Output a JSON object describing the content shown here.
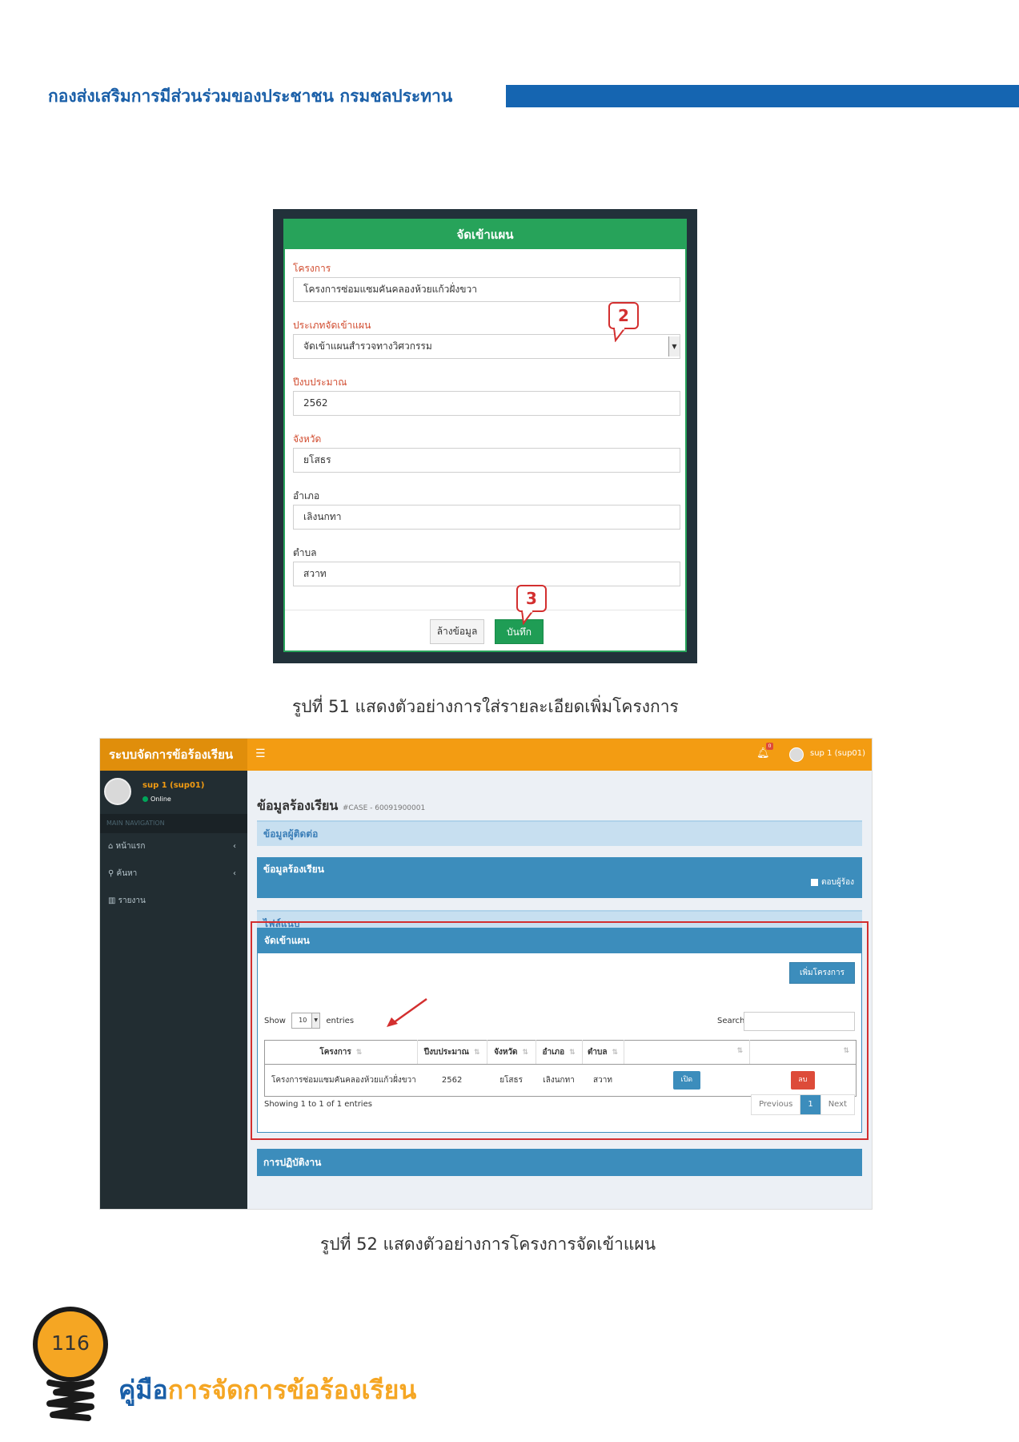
{
  "header": {
    "title": "กองส่งเสริมการมีส่วนร่วมของประชาชน กรมชลประทาน"
  },
  "figure51": {
    "panel_title": "จัดเข้าแผน",
    "fields": [
      {
        "label": "โครงการ",
        "value": "โครงการซ่อมแซมคันคลองห้วยแก้วฝั่งขวา"
      },
      {
        "label": "ประเภทจัดเข้าแผน",
        "value": "จัดเข้าแผนสำรวจทางวิศวกรรม"
      },
      {
        "label": "ปีงบประมาณ",
        "value": "2562"
      },
      {
        "label": "จังหวัด",
        "value": "ยโสธร"
      },
      {
        "label": "อำเภอ",
        "value": "เลิงนกทา"
      },
      {
        "label": "ตำบล",
        "value": "สวาท"
      }
    ],
    "clear_button": "ล้างข้อมูล",
    "save_button": "บันทึก",
    "callout_2": "2",
    "callout_3": "3",
    "caption": "รูปที่ 51 แสดงตัวอย่างการใส่รายละเอียดเพิ่มโครงการ"
  },
  "figure52": {
    "brand": "ระบบจัดการข้อร้องเรียน",
    "top_user": "sup 1 (sup01)",
    "notification_count": "0",
    "sidebar": {
      "user_name": "sup 1 (sup01)",
      "status": "Online",
      "nav_header": "MAIN NAVIGATION",
      "items": [
        {
          "icon": "home-icon",
          "label": "หน้าแรก"
        },
        {
          "icon": "search-icon",
          "label": "ค้นหา"
        },
        {
          "icon": "bar-chart-icon",
          "label": "รายงาน"
        }
      ]
    },
    "page_title": "ข้อมูลร้องเรียน",
    "case_id": "#CASE - 60091900001",
    "sections": {
      "contact": "ข้อมูลผู้ติดต่อ",
      "complaint": "ข้อมูลร้องเรียน",
      "reply_checkbox": "ตอบผู้ร้อง",
      "attachments": "ไฟล์แนบ",
      "plan": "จัดเข้าแผน",
      "operation": "การปฏิบัติงาน"
    },
    "add_project_button": "เพิ่มโครงการ",
    "table": {
      "show_label": "Show",
      "entries_value": "10",
      "entries_label": "entries",
      "search_label": "Search:",
      "columns": [
        "โครงการ",
        "ปีงบประมาณ",
        "จังหวัด",
        "อำเภอ",
        "ตำบล",
        "",
        ""
      ],
      "rows": [
        {
          "project": "โครงการซ่อมแซมคันคลองห้วยแก้วฝั่งขวา",
          "year": "2562",
          "province": "ยโสธร",
          "district": "เลิงนกทา",
          "subdistrict": "สวาท",
          "open_button": "เปิด",
          "delete_button": "ลบ"
        }
      ],
      "info": "Showing 1 to 1 of 1 entries",
      "prev": "Previous",
      "page": "1",
      "next": "Next"
    },
    "caption": "รูปที่ 52 แสดงตัวอย่างการโครงการจัดเข้าแผน"
  },
  "footer": {
    "page_number": "116",
    "title_part1": "คู่มือ",
    "title_part2": "การจัดการข้อร้องเรียน"
  }
}
